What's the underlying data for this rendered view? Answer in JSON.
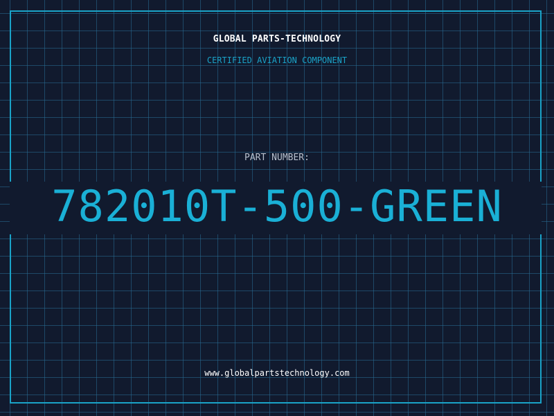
{
  "header": {
    "company": "GLOBAL PARTS-TECHNOLOGY",
    "subtitle": "CERTIFIED AVIATION COMPONENT"
  },
  "part": {
    "label": "PART NUMBER:",
    "number": "782010T-500-GREEN"
  },
  "footer": {
    "website": "www.globalpartstechnology.com"
  },
  "colors": {
    "background": "#111a2e",
    "accent": "#1ab0d6",
    "grid": "#286e96",
    "text": "#ffffff",
    "label": "#b9c2cf"
  }
}
